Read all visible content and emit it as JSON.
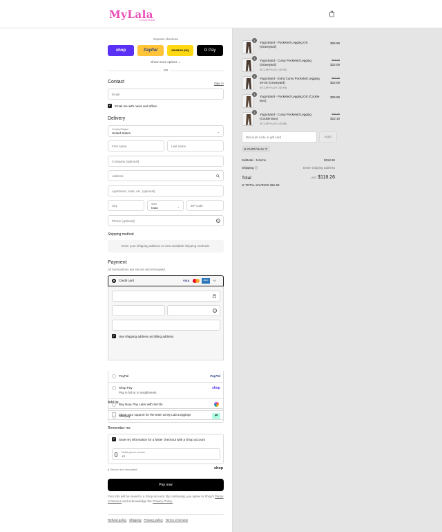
{
  "header": {
    "logo_text": "MyLala",
    "logo_sub": "LEGGINGS"
  },
  "express": {
    "title": "Express checkout",
    "shop_label": "shop",
    "paypal_label": "PayPal",
    "amazon_label": "amazon pay",
    "gpay_label": "G Pay",
    "show_more": "Show more options",
    "or": "OR"
  },
  "contact": {
    "heading": "Contact",
    "sign_in": "Sign in",
    "email_placeholder": "Email",
    "news_label": "Email me with news and offers"
  },
  "delivery": {
    "heading": "Delivery",
    "country_label": "Country/Region",
    "country_value": "United States",
    "first_name": "First name",
    "last_name": "Last name",
    "company": "Company (optional)",
    "address": "Address",
    "apartment": "Apartment, suite, etc. (optional)",
    "city": "City",
    "state_label": "State",
    "state_value": "Iowa",
    "zip": "ZIP code",
    "phone": "Phone (optional)"
  },
  "shipping": {
    "heading": "Shipping method",
    "notice": "Enter your shipping address to view available shipping methods."
  },
  "payment": {
    "heading": "Payment",
    "subtitle": "All transactions are secure and encrypted.",
    "credit_card": "Credit card",
    "more_cards": "+5",
    "billing_same": "Use shipping address as billing address",
    "paypal": "PayPal",
    "shop_pay": "Shop Pay",
    "shop_pay_sub": "Pay in full or in installments",
    "sezzle": "Buy Now, Pay Later with Sezzle",
    "afterpay": "Afterpay"
  },
  "tip": {
    "heading": "Add tip",
    "label": "Show your support for the team at My Lala Leggings"
  },
  "remember": {
    "heading": "Remember me",
    "save_label": "Save my information for a faster checkout with a Shop account",
    "phone_label": "Mobile phone number",
    "phone_value": "+1",
    "secure": "Secure and encrypted",
    "shop_logo": "shop"
  },
  "pay_now": "Pay now",
  "terms": {
    "text1": "Your info will be saved to a Shop account. By continuing, you agree to Shop's",
    "tos": "Terms of Service",
    "and": "and acknowledge the",
    "privacy": "Privacy Policy."
  },
  "footer_links": [
    "Refund policy",
    "Shipping",
    "Privacy policy",
    "Terms of service"
  ],
  "cart": {
    "items": [
      {
        "qty": "1",
        "name": "Yoga Band - Pocketed Legging OS (Graveyard)",
        "price": "$25.99",
        "original": "",
        "discount": ""
      },
      {
        "qty": "1",
        "name": "Yoga Band - Curvy Pocketed Legging (Graveyard)",
        "price": "$22.09",
        "original": "$25.99",
        "discount": "CURVYLUV (-$3.90)"
      },
      {
        "qty": "1",
        "name": "Yoga Band - Extra Curvy Pocketed Legging 20-26 (Graveyard)",
        "price": "$22.09",
        "original": "$25.99",
        "discount": "CURVYLUV (-$3.90)"
      },
      {
        "qty": "1",
        "name": "Yoga Band - Pocketed Legging OS (Cookie Boo)",
        "price": "$25.99",
        "original": "",
        "discount": ""
      },
      {
        "qty": "1",
        "name": "Yoga Band - Curvy Pocketed Legging (Cookie Boo)",
        "price": "$22.10",
        "original": "$25.99",
        "discount": "CURVYLUV (-$3.89)"
      }
    ],
    "discount_placeholder": "Discount code or gift card",
    "apply": "Apply",
    "code_tag": "CURVYLUV",
    "subtotal_label": "Subtotal · 5 items",
    "subtotal_value": "$118.26",
    "shipping_label": "Shipping",
    "shipping_value": "Enter shipping address",
    "total_label": "Total",
    "currency": "USD",
    "total_value": "$118.26",
    "savings_label": "TOTAL SAVINGS",
    "savings_value": "$11.69"
  }
}
